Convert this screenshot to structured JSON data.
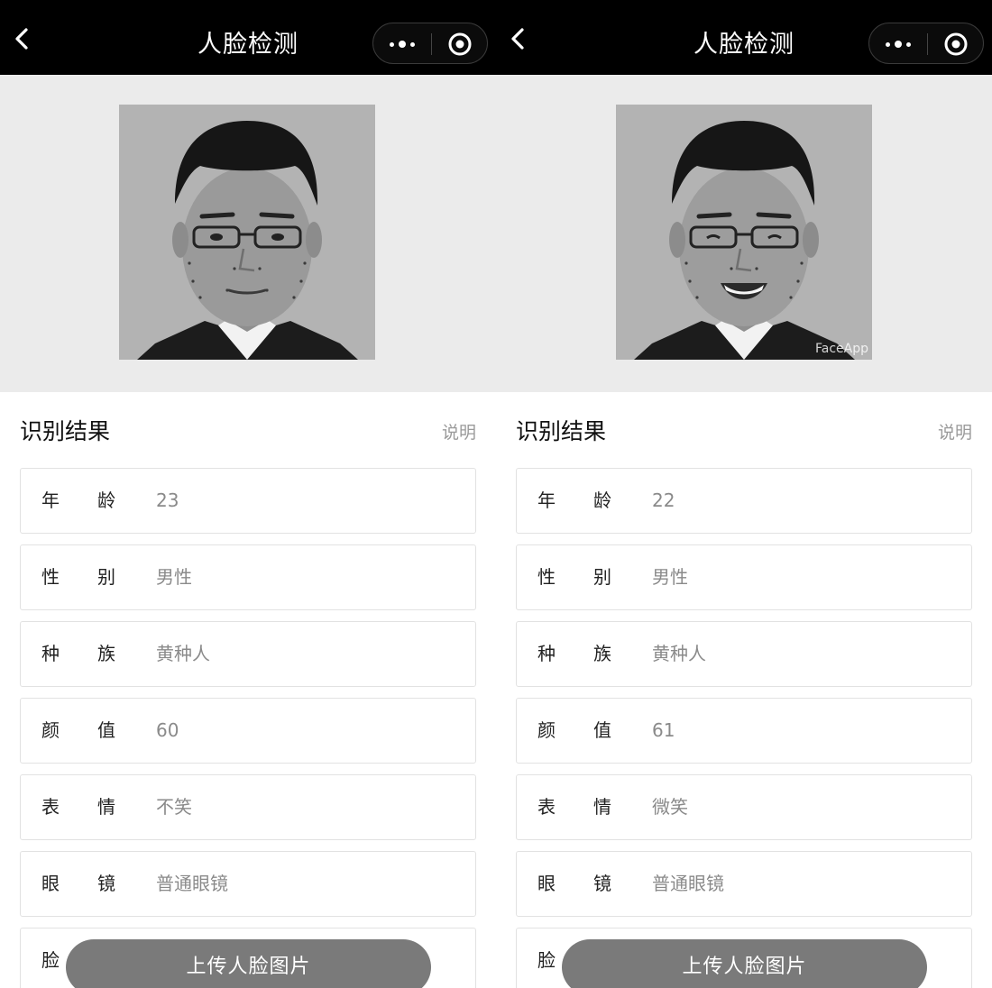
{
  "panels": [
    {
      "nav_title": "人脸检测",
      "section_title": "识别结果",
      "explain_label": "说明",
      "rows": [
        {
          "k1": "年",
          "k2": "龄",
          "value": "23"
        },
        {
          "k1": "性",
          "k2": "别",
          "value": "男性"
        },
        {
          "k1": "种",
          "k2": "族",
          "value": "黄种人"
        },
        {
          "k1": "颜",
          "k2": "值",
          "value": "60"
        },
        {
          "k1": "表",
          "k2": "情",
          "value": "不笑"
        },
        {
          "k1": "眼",
          "k2": "镜",
          "value": "普通眼镜"
        },
        {
          "k1": "脸",
          "k2": "",
          "value": ""
        }
      ],
      "upload_label": "上传人脸图片",
      "watermark": ""
    },
    {
      "nav_title": "人脸检测",
      "section_title": "识别结果",
      "explain_label": "说明",
      "rows": [
        {
          "k1": "年",
          "k2": "龄",
          "value": "22"
        },
        {
          "k1": "性",
          "k2": "别",
          "value": "男性"
        },
        {
          "k1": "种",
          "k2": "族",
          "value": "黄种人"
        },
        {
          "k1": "颜",
          "k2": "值",
          "value": "61"
        },
        {
          "k1": "表",
          "k2": "情",
          "value": "微笑"
        },
        {
          "k1": "眼",
          "k2": "镜",
          "value": "普通眼镜"
        },
        {
          "k1": "脸",
          "k2": "",
          "value": ""
        }
      ],
      "upload_label": "上传人脸图片",
      "watermark": "FaceApp"
    }
  ],
  "icons": {
    "back": "chevron-left-icon",
    "more": "more-dots-icon",
    "close": "target-circle-icon"
  },
  "colors": {
    "navbar": "#000000",
    "photo_bg": "#ebebeb",
    "upload_button": "#7a7a7a",
    "value_text": "#8a8a8a"
  }
}
